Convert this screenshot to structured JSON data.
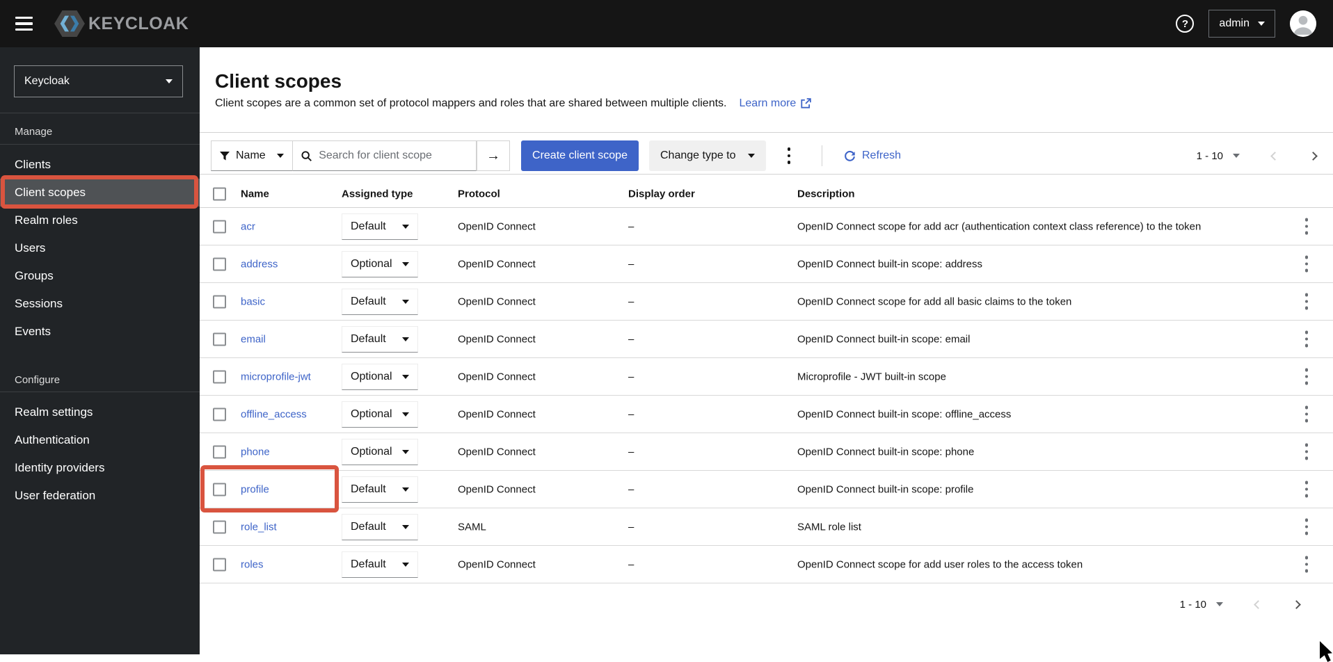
{
  "header": {
    "brand": "KEYCLOAK",
    "help_glyph": "?",
    "user_menu": "admin"
  },
  "sidebar": {
    "realm_selector": "Keycloak",
    "sections": [
      {
        "label": "Manage",
        "selected": "Client scopes",
        "items": [
          "Clients",
          "Client scopes",
          "Realm roles",
          "Users",
          "Groups",
          "Sessions",
          "Events"
        ]
      },
      {
        "label": "Configure",
        "items": [
          "Realm settings",
          "Authentication",
          "Identity providers",
          "User federation"
        ]
      }
    ]
  },
  "page": {
    "title": "Client scopes",
    "description": "Client scopes are a common set of protocol mappers and roles that are shared between multiple clients.",
    "learn_more": "Learn more"
  },
  "toolbar": {
    "filter_label": "Name",
    "search_placeholder": "Search for client scope",
    "create_button": "Create client scope",
    "change_type_button": "Change type to",
    "refresh_label": "Refresh",
    "pagination": "1 - 10"
  },
  "table": {
    "columns": [
      "Name",
      "Assigned type",
      "Protocol",
      "Display order",
      "Description"
    ],
    "rows": [
      {
        "name": "acr",
        "assigned_type": "Default",
        "protocol": "OpenID Connect",
        "display_order": "–",
        "description": "OpenID Connect scope for add acr (authentication context class reference) to the token"
      },
      {
        "name": "address",
        "assigned_type": "Optional",
        "protocol": "OpenID Connect",
        "display_order": "–",
        "description": "OpenID Connect built-in scope: address"
      },
      {
        "name": "basic",
        "assigned_type": "Default",
        "protocol": "OpenID Connect",
        "display_order": "–",
        "description": "OpenID Connect scope for add all basic claims to the token"
      },
      {
        "name": "email",
        "assigned_type": "Default",
        "protocol": "OpenID Connect",
        "display_order": "–",
        "description": "OpenID Connect built-in scope: email"
      },
      {
        "name": "microprofile-jwt",
        "assigned_type": "Optional",
        "protocol": "OpenID Connect",
        "display_order": "–",
        "description": "Microprofile - JWT built-in scope"
      },
      {
        "name": "offline_access",
        "assigned_type": "Optional",
        "protocol": "OpenID Connect",
        "display_order": "–",
        "description": "OpenID Connect built-in scope: offline_access"
      },
      {
        "name": "phone",
        "assigned_type": "Optional",
        "protocol": "OpenID Connect",
        "display_order": "–",
        "description": "OpenID Connect built-in scope: phone"
      },
      {
        "name": "profile",
        "assigned_type": "Default",
        "protocol": "OpenID Connect",
        "display_order": "–",
        "description": "OpenID Connect built-in scope: profile",
        "highlighted": true
      },
      {
        "name": "role_list",
        "assigned_type": "Default",
        "protocol": "SAML",
        "display_order": "–",
        "description": "SAML role list"
      },
      {
        "name": "roles",
        "assigned_type": "Default",
        "protocol": "OpenID Connect",
        "display_order": "–",
        "description": "OpenID Connect scope for add user roles to the access token"
      }
    ]
  },
  "pagination_bottom": "1 - 10",
  "colors": {
    "primary_blue": "#3e64c8",
    "link_blue": "#3e64c8",
    "annotation_red": "#d9543f",
    "masthead_bg": "#151515",
    "sidebar_bg": "#212427",
    "selected_nav_bg": "#4f5255"
  }
}
